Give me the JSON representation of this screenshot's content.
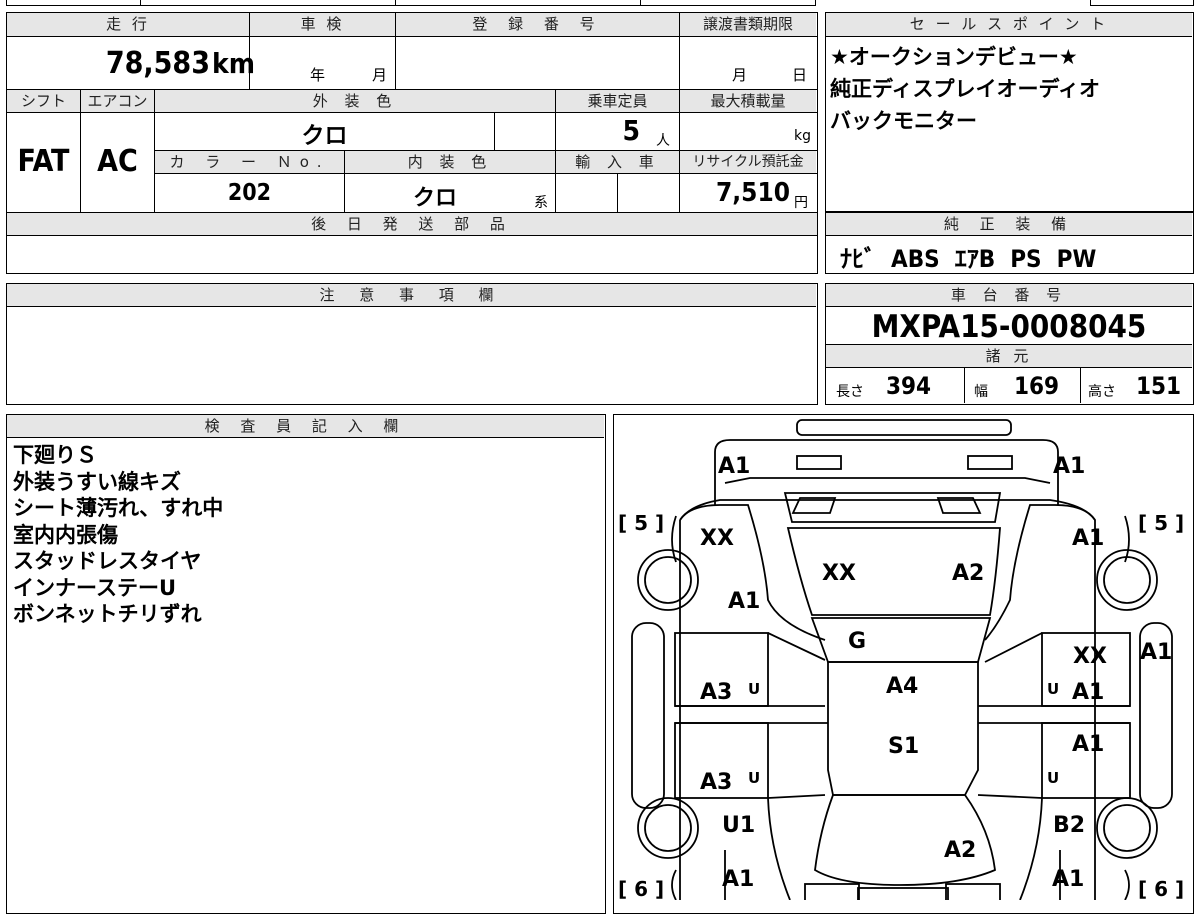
{
  "labels": {
    "mileage": "走 行",
    "inspection": "車 検",
    "registration": "登 録 番 号",
    "transfer_deadline": "譲渡書類期限",
    "selling_points": "セ ー ル ス ポ イ ン ト",
    "shift": "シフト",
    "aircon": "エアコン",
    "exterior_color": "外 装 色",
    "capacity": "乗車定員",
    "max_load": "最大積載量",
    "color_no": "カ ラ ー Ｎo.",
    "interior_color": "内 装 色",
    "import": "輸 入 車",
    "recycle": "リサイクル預託金",
    "later_parts": "後 日 発 送 部 品",
    "standard_equipment": "純 正 装 備",
    "caution": "注 意 事 項 欄",
    "chassis_no": "車 台 番 号",
    "specs": "諸 元",
    "inspector_notes": "検 査 員 記 入 欄",
    "year": "年",
    "month": "月",
    "day": "日",
    "unit_person": "人",
    "unit_kg": "kg",
    "unit_yen": "円",
    "suffix_kei": "系",
    "length": "長さ",
    "width": "幅",
    "height": "高さ"
  },
  "values": {
    "mileage": "78,583",
    "mileage_unit": "km",
    "shift": "FAT",
    "aircon": "AC",
    "exterior_color": "クロ",
    "capacity": "5",
    "color_no": "202",
    "interior_color": "クロ",
    "recycle": "7,510",
    "equipment": "ﾅﾋﾞ  ABS  ｴｱB  PS  PW",
    "chassis_no": "MXPA15-0008045",
    "length": "394",
    "width": "169",
    "height": "151"
  },
  "selling_points": [
    "★オークションデビュー★",
    "純正ディスプレイオーディオ",
    "バックモニター"
  ],
  "inspector_notes": [
    "下廻りＳ",
    "外装うすい線キズ",
    "シート薄汚れ、すれ中",
    "室内内張傷",
    "スタッドレスタイヤ",
    "インナーステーU",
    "ボンネットチリずれ"
  ],
  "diagram": {
    "marks": {
      "front_left": "A1",
      "front_right": "A1",
      "fl_fender": "XX",
      "fl_lower": "A1",
      "fr_fender": "A1",
      "hood_left": "XX",
      "hood_right": "A2",
      "windshield": "G",
      "r_front_door_top": "XX",
      "r_front_door": "A1",
      "r_pillar": "A1",
      "l_front_door": "A3",
      "roof": "A4",
      "l_rear_door": "A3",
      "interior": "S1",
      "r_rear_door": "A1",
      "rl_wheel": "U1",
      "rr_wheel": "B2",
      "tailgate": "A2",
      "rear_left": "A1",
      "rear_right": "A1"
    },
    "small_marks": {
      "l_front_door": "U",
      "l_rear_door": "U",
      "r_front_door": "U",
      "r_rear_door": "U"
    },
    "tire_depth": {
      "front_left": "[ 5 ]",
      "front_right": "[ 5 ]",
      "rear_left": "[ 6 ]",
      "rear_right": "[ 6 ]"
    }
  }
}
